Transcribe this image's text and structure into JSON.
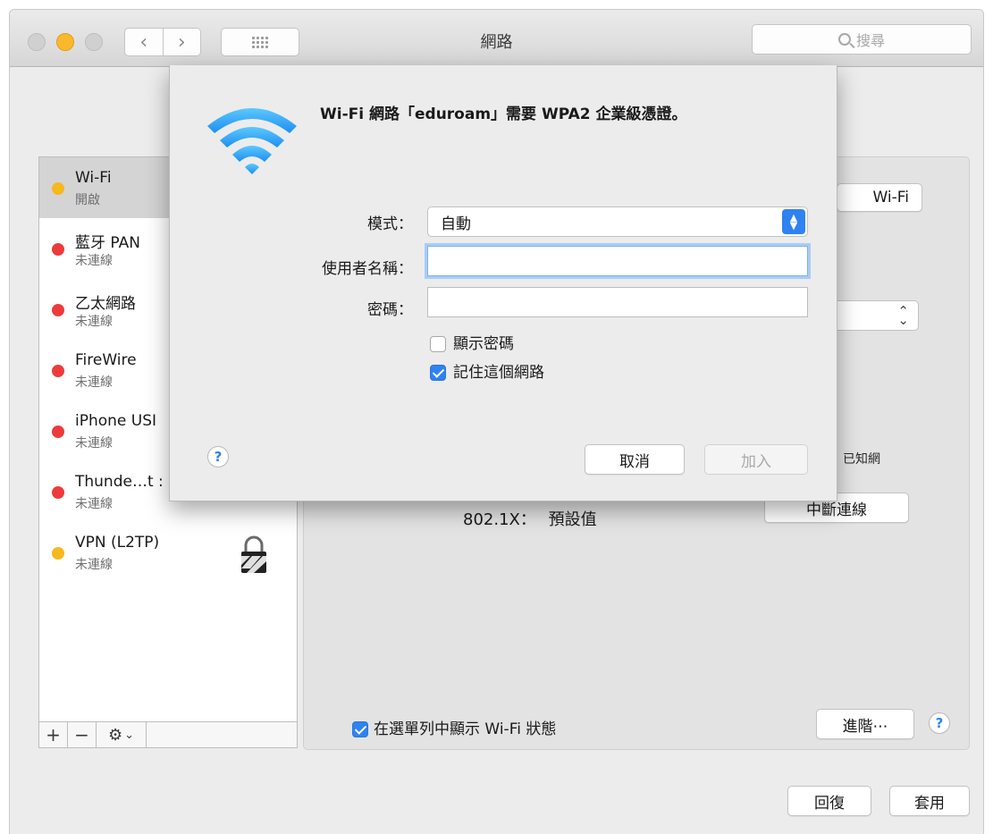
{
  "window": {
    "title": "網路",
    "search_placeholder": "搜尋"
  },
  "services": [
    {
      "name": "Wi-Fi",
      "status": "開啟",
      "dot": "#f6b81f"
    },
    {
      "name": "藍牙 PAN",
      "status": "未連線",
      "dot": "#ed3b3b"
    },
    {
      "name": "乙太網路",
      "status": "未連線",
      "dot": "#ed3b3b"
    },
    {
      "name": "FireWire",
      "status": "未連線",
      "dot": "#ed3b3b"
    },
    {
      "name": "iPhone USI",
      "status": "未連線",
      "dot": "#ed3b3b"
    },
    {
      "name": "Thunde…t :",
      "status": "未連線",
      "dot": "#ed3b3b"
    },
    {
      "name": "VPN (L2TP)",
      "status": "未連線",
      "dot": "#f6b81f"
    }
  ],
  "sidebar_buttons": {
    "add": "+",
    "remove": "−",
    "gear_chevron": "⌄"
  },
  "panel": {
    "wifi_button": "Wi-Fi",
    "known_networks_fragment": "已知網",
    "dot1x_label": "802.1X：",
    "dot1x_value": "預設值",
    "disconnect_button": "中斷連線",
    "show_wifi_status_label": "在選單列中顯示 Wi-Fi 狀態",
    "show_wifi_status_checked": true,
    "advanced_button": "進階⋯",
    "help": "?"
  },
  "footer": {
    "revert_button": "回復",
    "apply_button": "套用"
  },
  "dialog": {
    "message": "Wi-Fi 網路「eduroam」需要 WPA2 企業級憑證。",
    "mode_label": "模式：",
    "mode_value": "自動",
    "username_label": "使用者名稱：",
    "username_value": "",
    "password_label": "密碼：",
    "password_value": "",
    "show_password_label": "顯示密碼",
    "show_password_checked": false,
    "remember_network_label": "記住這個網路",
    "remember_network_checked": true,
    "help": "?",
    "cancel_button": "取消",
    "join_button": "加入"
  },
  "colors": {
    "accent": "#2f82f0",
    "status_on": "#f6b81f",
    "status_off": "#ed3b3b"
  }
}
